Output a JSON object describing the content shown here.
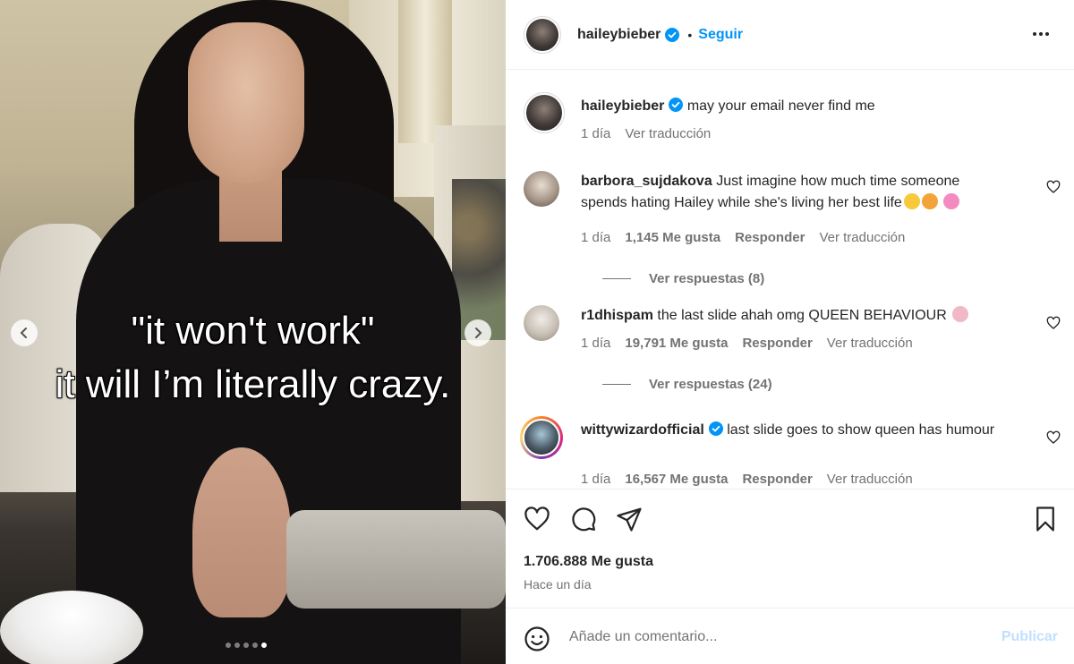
{
  "media": {
    "caption_line1": "\"it won't work\"",
    "caption_line2": "it will I’m literally crazy.",
    "carousel_total": 5,
    "carousel_active": 5
  },
  "post": {
    "author": "haileybieber",
    "follow_label": "Seguir",
    "separator": "•",
    "caption": "may your email never find me",
    "caption_time": "1 día",
    "caption_translate": "Ver traducción"
  },
  "comments": [
    {
      "user": "barbora_sujdakova",
      "text": "Just imagine how much time someone spends hating Hailey while she's living her best life",
      "time": "1 día",
      "likes": "1,145 Me gusta",
      "reply": "Responder",
      "translate": "Ver traducción",
      "replies": "Ver respuestas (8)"
    },
    {
      "user": "r1dhispam",
      "text": "the last slide ahah omg QUEEN BEHAVIOUR",
      "time": "1 día",
      "likes": "19,791 Me gusta",
      "reply": "Responder",
      "translate": "Ver traducción",
      "replies": "Ver respuestas (24)"
    },
    {
      "user": "wittywizardofficial",
      "text": "last slide goes to show queen has humour",
      "time": "1 día",
      "likes": "16,567 Me gusta",
      "reply": "Responder",
      "translate": "Ver traducción"
    }
  ],
  "actions": {
    "likes": "1.706.888 Me gusta",
    "when": "Hace un día"
  },
  "composer": {
    "placeholder": "Añade un comentario...",
    "publish": "Publicar"
  },
  "colors": {
    "accent": "#0095f6",
    "verified": "#0095f6",
    "muted": "#737373",
    "publish_disabled": "#c0dffd"
  }
}
